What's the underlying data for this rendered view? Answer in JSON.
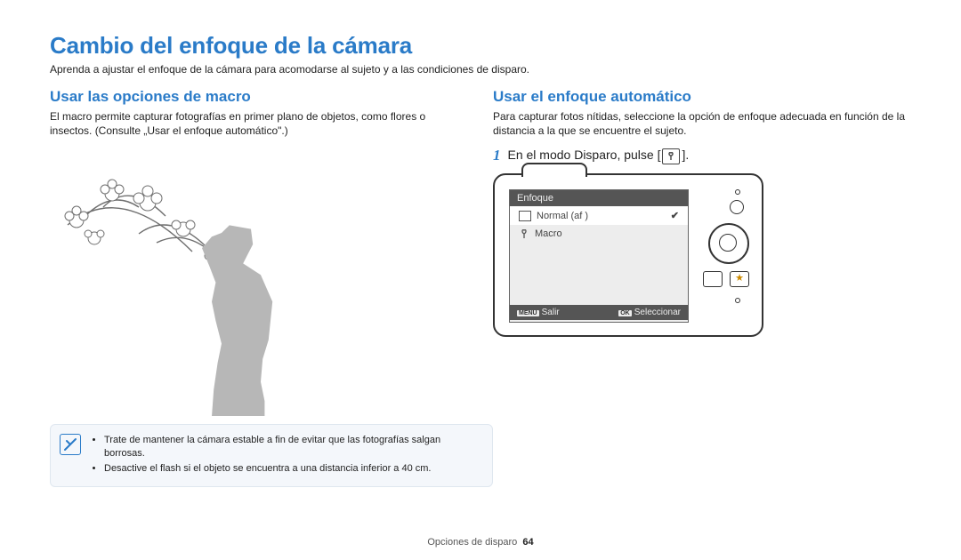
{
  "page": {
    "title": "Cambio del enfoque de la cámara",
    "subtitle": "Aprenda a ajustar el enfoque de la cámara para acomodarse al sujeto y a las condiciones de disparo.",
    "footer_section": "Opciones de disparo",
    "footer_page": "64"
  },
  "left": {
    "heading": "Usar las opciones de macro",
    "body": "El macro permite capturar fotografías en primer plano de objetos, como flores o insectos. (Consulte „Usar el enfoque automático\".)",
    "notes": [
      "Trate de mantener la cámara estable a fin de evitar que las fotografías salgan borrosas.",
      "Desactive el flash si el objeto se encuentra a una distancia inferior a 40 cm."
    ]
  },
  "right": {
    "heading": "Usar el enfoque automático",
    "body": "Para capturar fotos nítidas, seleccione la opción de enfoque adecuada en función de la distancia a la que se encuentre el sujeto.",
    "step_num": "1",
    "step_text_before": "En el modo Disparo, pulse [",
    "step_text_after": "].",
    "camera_screen": {
      "menu_title": "Enfoque",
      "option_selected": "Normal (af )",
      "option_other": "Macro",
      "footer_left_badge": "MENU",
      "footer_left_text": "Salir",
      "footer_right_badge": "OK",
      "footer_right_text": "Seleccionar"
    }
  }
}
